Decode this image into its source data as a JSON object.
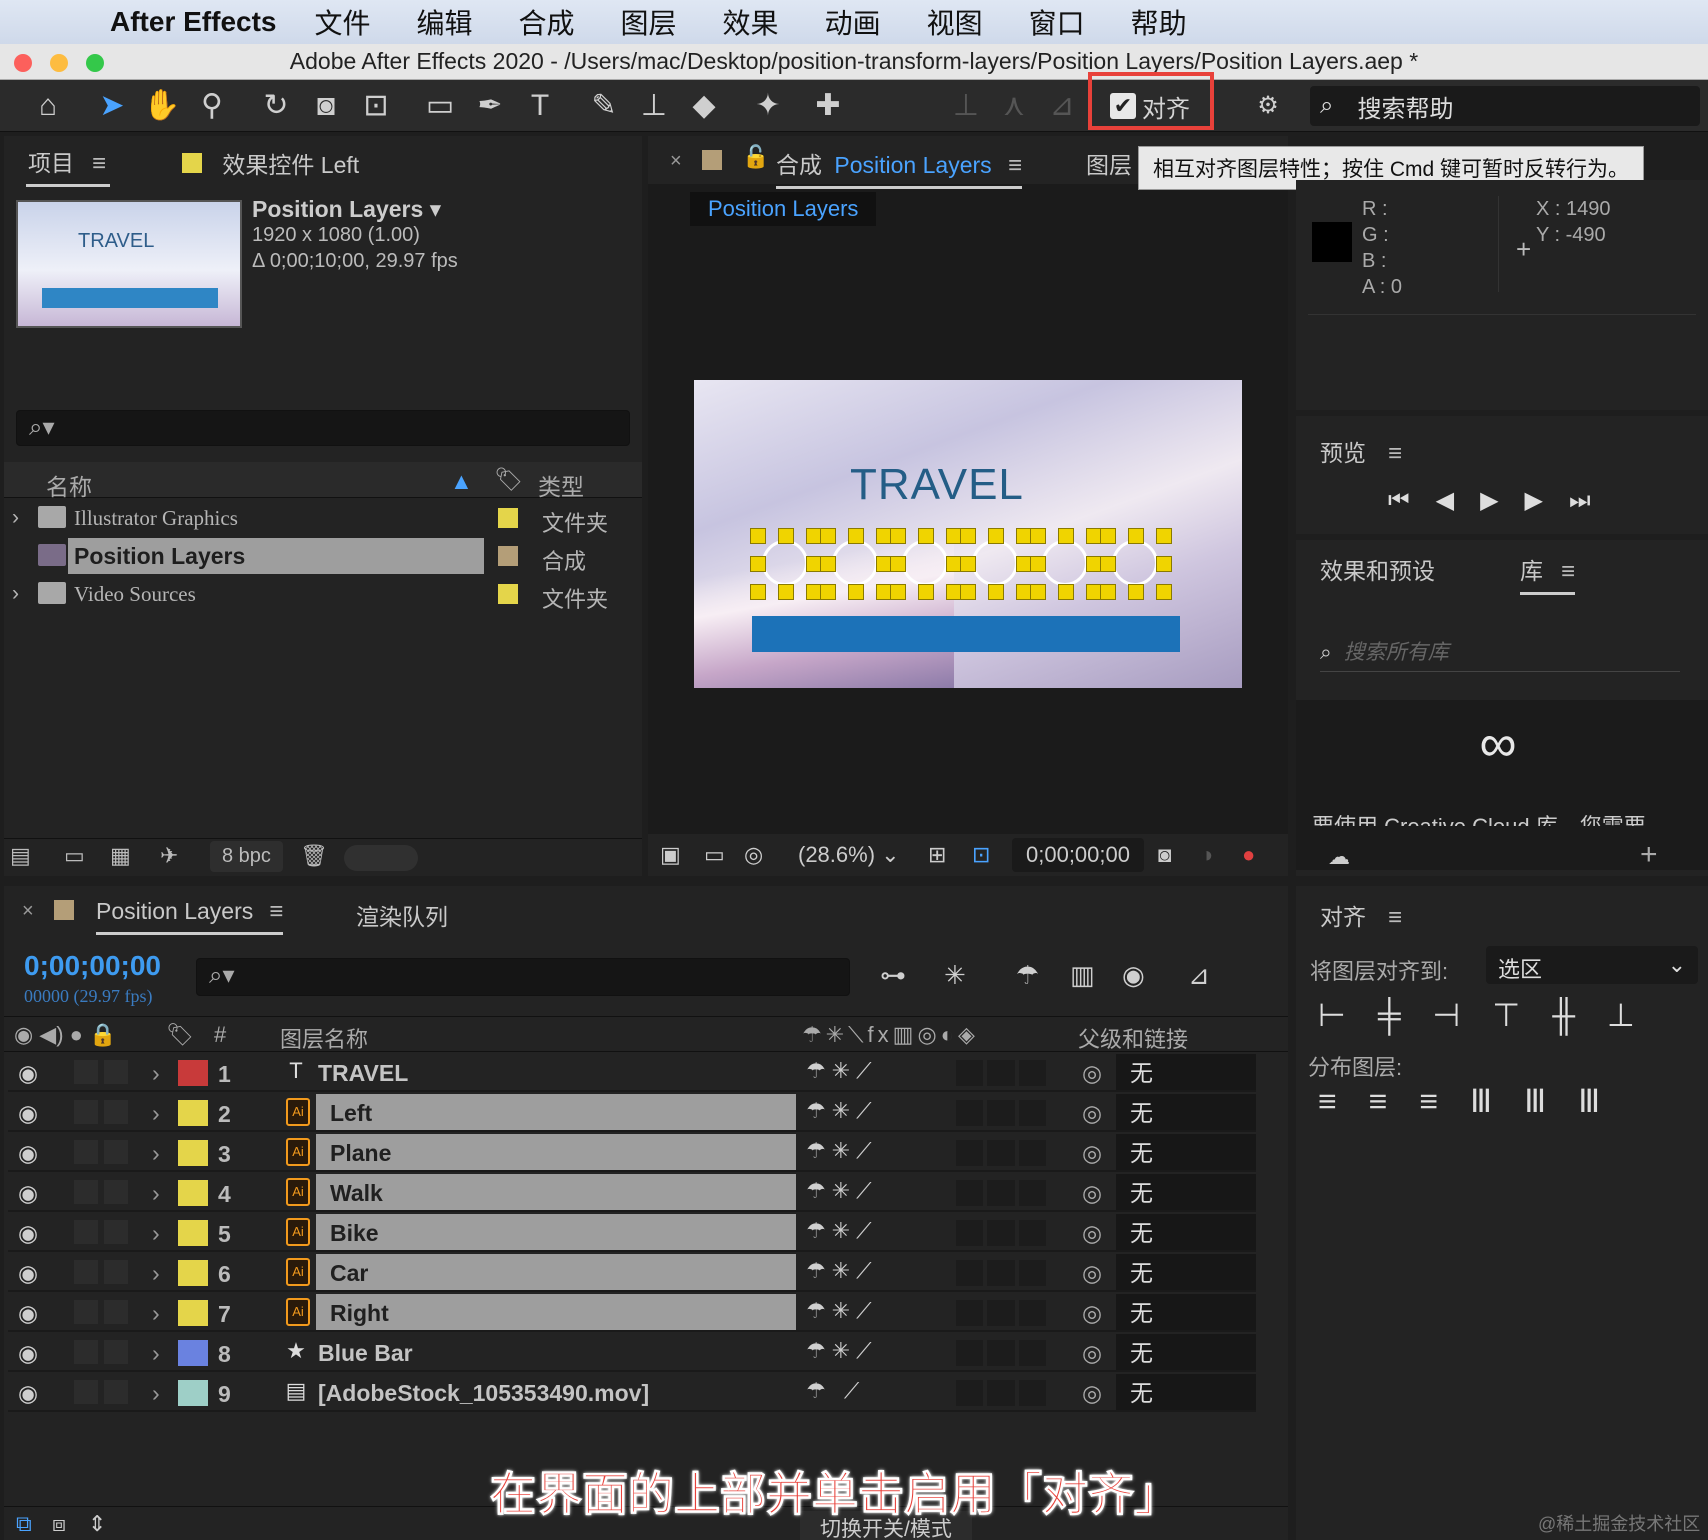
{
  "menubar": {
    "app": "After Effects",
    "items": [
      "文件",
      "编辑",
      "合成",
      "图层",
      "效果",
      "动画",
      "视图",
      "窗口",
      "帮助"
    ]
  },
  "window": {
    "title": "Adobe After Effects 2020 - /Users/mac/Desktop/position-transform-layers/Position Layers/Position Layers.aep *"
  },
  "toolbar": {
    "align_label": "对齐",
    "align_checked": true,
    "search_help": "搜索帮助"
  },
  "tooltip": "相互对齐图层特性；按住 Cmd 键可暂时反转行为。",
  "project": {
    "tab": "项目",
    "effects_tab": "效果控件 Left",
    "comp_name": "Position Layers",
    "comp_size": "1920 x 1080 (1.00)",
    "comp_duration": "Δ 0;00;10;00, 29.97 fps",
    "thumb_text": "TRAVEL",
    "col_name": "名称",
    "col_type": "类型",
    "items": [
      {
        "name": "Illustrator Graphics",
        "type": "文件夹",
        "kind": "folder",
        "color": "#e4d54a"
      },
      {
        "name": "Position Layers",
        "type": "合成",
        "kind": "comp",
        "color": "#b49e78"
      },
      {
        "name": "Video Sources",
        "type": "文件夹",
        "kind": "folder",
        "color": "#e4d54a"
      }
    ],
    "bpc": "8 bpc"
  },
  "composition": {
    "tab_prefix": "合成",
    "tab_name": "Position Layers",
    "layer_tab": "图层",
    "breadcrumb": "Position Layers",
    "preview_title": "TRAVEL",
    "zoom": "(28.6%)",
    "timecode": "0;00;00;00"
  },
  "info": {
    "r": "R :",
    "g": "G :",
    "b": "B :",
    "a": "A :  0",
    "x": "X :  1490",
    "y": "Y :  -490"
  },
  "preview_panel": {
    "title": "预览"
  },
  "effects_panel": {
    "tab1": "效果和预设",
    "tab2": "库",
    "search_placeholder": "搜索所有库",
    "cc_text": "要使用 Creative Cloud 库，您需要"
  },
  "timeline": {
    "tab": "Position Layers",
    "render_tab": "渲染队列",
    "timecode": "0;00;00;00",
    "frames": "00000 (29.97 fps)",
    "col_hash": "#",
    "col_layer_name": "图层名称",
    "col_parent": "父级和链接",
    "toggle_modes": "切换开关/模式",
    "layers": [
      {
        "num": "1",
        "name": "TRAVEL",
        "color": "#c83a3a",
        "kind": "text",
        "selected": false,
        "parent": "无"
      },
      {
        "num": "2",
        "name": "Left",
        "color": "#e4d54a",
        "kind": "ai",
        "selected": true,
        "parent": "无"
      },
      {
        "num": "3",
        "name": "Plane",
        "color": "#e4d54a",
        "kind": "ai",
        "selected": true,
        "parent": "无"
      },
      {
        "num": "4",
        "name": "Walk",
        "color": "#e4d54a",
        "kind": "ai",
        "selected": true,
        "parent": "无"
      },
      {
        "num": "5",
        "name": "Bike",
        "color": "#e4d54a",
        "kind": "ai",
        "selected": true,
        "parent": "无"
      },
      {
        "num": "6",
        "name": "Car",
        "color": "#e4d54a",
        "kind": "ai",
        "selected": true,
        "parent": "无"
      },
      {
        "num": "7",
        "name": "Right",
        "color": "#e4d54a",
        "kind": "ai",
        "selected": true,
        "parent": "无"
      },
      {
        "num": "8",
        "name": "Blue Bar",
        "color": "#6a82e0",
        "kind": "shape",
        "selected": false,
        "parent": "无"
      },
      {
        "num": "9",
        "name": "[AdobeStock_105353490.mov]",
        "color": "#9ecfc7",
        "kind": "video",
        "selected": false,
        "parent": "无"
      }
    ]
  },
  "align_panel": {
    "title": "对齐",
    "align_to_label": "将图层对齐到:",
    "align_to_value": "选区",
    "distribute_label": "分布图层:"
  },
  "caption": "在界面的上部并单击启用「对齐」",
  "watermark": "@稀土掘金技术社区"
}
